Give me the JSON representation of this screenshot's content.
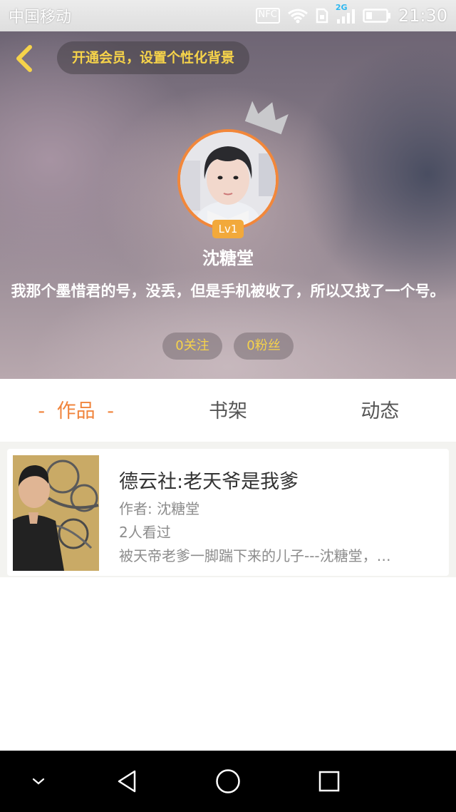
{
  "status_bar": {
    "carrier": "中国移动",
    "nfc": "NFC",
    "network": "2G",
    "time": "21:30"
  },
  "header": {
    "vip_banner": "开通会员，设置个性化背景",
    "level": "Lv1",
    "username": "沈糖堂",
    "bio": "我那个墨惜君的号，没丢，但是手机被收了，所以又找了一个号。",
    "follow_label": "0关注",
    "fans_label": "0粉丝"
  },
  "tabs": [
    {
      "label": "作品",
      "active": true
    },
    {
      "label": "书架",
      "active": false
    },
    {
      "label": "动态",
      "active": false
    }
  ],
  "tab_dash": "-",
  "books": [
    {
      "title": "德云社:老天爷是我爹",
      "author": "作者: 沈糖堂",
      "views": "2人看过",
      "desc": "被天帝老爹一脚踹下来的儿子---沈糖堂，…"
    }
  ],
  "colors": {
    "accent": "#f0843c",
    "gold": "#f6d34a",
    "level_badge": "#f2a93b"
  },
  "icons": {
    "back": "chevron-left-icon",
    "crown": "crown-icon",
    "nav_down": "chevron-down-icon",
    "nav_back": "triangle-back-icon",
    "nav_home": "circle-home-icon",
    "nav_recent": "square-recent-icon"
  }
}
